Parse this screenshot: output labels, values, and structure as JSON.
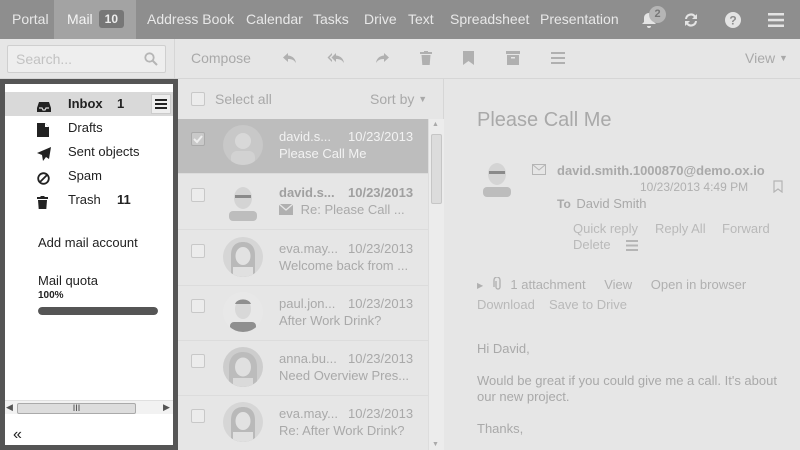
{
  "topbar": {
    "portal": "Portal",
    "mail": "Mail",
    "mail_count": "10",
    "address_book": "Address Book",
    "calendar": "Calendar",
    "tasks": "Tasks",
    "drive": "Drive",
    "text": "Text",
    "spreadsheet": "Spreadsheet",
    "presentation": "Presentation",
    "notification_count": "2"
  },
  "toolbar": {
    "search_placeholder": "Search...",
    "compose": "Compose",
    "view": "View"
  },
  "folders": {
    "items": [
      {
        "label": "Inbox",
        "count": "1",
        "icon": "inbox-icon"
      },
      {
        "label": "Drafts",
        "count": "",
        "icon": "drafts-icon"
      },
      {
        "label": "Sent objects",
        "count": "",
        "icon": "sent-icon"
      },
      {
        "label": "Spam",
        "count": "",
        "icon": "spam-icon"
      },
      {
        "label": "Trash",
        "count": "11",
        "icon": "trash-icon"
      }
    ],
    "add_account": "Add mail account",
    "quota_label": "Mail quota",
    "quota_value": "100%",
    "quota_fraction": 1.0,
    "collapse": "«",
    "scroll_thumb": "III"
  },
  "list": {
    "select_all": "Select all",
    "sort_by": "Sort by",
    "mails": [
      {
        "from": "david.s...",
        "date": "10/23/2013",
        "subject": "Please Call Me"
      },
      {
        "from": "david.s...",
        "date": "10/23/2013",
        "subject": "Re: Please Call ..."
      },
      {
        "from": "eva.may...",
        "date": "10/23/2013",
        "subject": "Welcome back from ..."
      },
      {
        "from": "paul.jon...",
        "date": "10/23/2013",
        "subject": "After Work Drink?"
      },
      {
        "from": "anna.bu...",
        "date": "10/23/2013",
        "subject": "Need Overview Pres..."
      },
      {
        "from": "eva.may...",
        "date": "10/23/2013",
        "subject": "Re: After Work Drink?"
      }
    ]
  },
  "detail": {
    "subject": "Please Call Me",
    "from": "david.smith.1000870@demo.ox.io",
    "date": "10/23/2013 4:49 PM",
    "to_label": "To",
    "to_name": "David Smith",
    "actions": {
      "quick_reply": "Quick reply",
      "reply_all": "Reply All",
      "forward": "Forward",
      "delete": "Delete"
    },
    "attachments": {
      "count_label": "1 attachment",
      "view": "View",
      "open_in_browser": "Open in browser",
      "download": "Download",
      "save_to_drive": "Save to Drive"
    },
    "body": {
      "greeting": "Hi David,",
      "paragraph": "Would be great if you could give me a call. It's about our new project.",
      "closing": "Thanks,"
    }
  },
  "colors": {
    "topbar_bg": "#8e8e8e",
    "page_bg": "#e6e6e6",
    "panel_border": "#555555"
  }
}
